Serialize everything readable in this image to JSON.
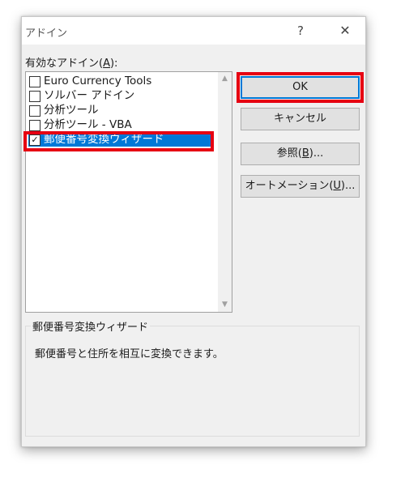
{
  "dialog": {
    "title": "アドイン",
    "help_glyph": "?",
    "close_glyph": "✕"
  },
  "addins_label": {
    "prefix": "有効なアドイン(",
    "mnemonic": "A",
    "suffix": "):"
  },
  "addins": [
    {
      "name": "Euro Currency Tools",
      "checked": false,
      "selected": false
    },
    {
      "name": "ソルバー アドイン",
      "checked": false,
      "selected": false
    },
    {
      "name": "分析ツール",
      "checked": false,
      "selected": false
    },
    {
      "name": "分析ツール - VBA",
      "checked": false,
      "selected": false
    },
    {
      "name": "郵便番号変換ウィザード",
      "checked": true,
      "selected": true
    }
  ],
  "buttons": {
    "ok": "OK",
    "cancel": "キャンセル",
    "browse": {
      "prefix": "参照(",
      "mnemonic": "B",
      "suffix": ")..."
    },
    "automation": {
      "prefix": "オートメーション(",
      "mnemonic": "U",
      "suffix": ")..."
    }
  },
  "description": {
    "title": "郵便番号変換ウィザード",
    "text": "郵便番号と住所を相互に変換できます。"
  },
  "colors": {
    "selection": "#0078d7",
    "highlight_box": "#e60012"
  },
  "icons": {
    "check": "✓",
    "scroll_up": "▲",
    "scroll_down": "▼"
  }
}
